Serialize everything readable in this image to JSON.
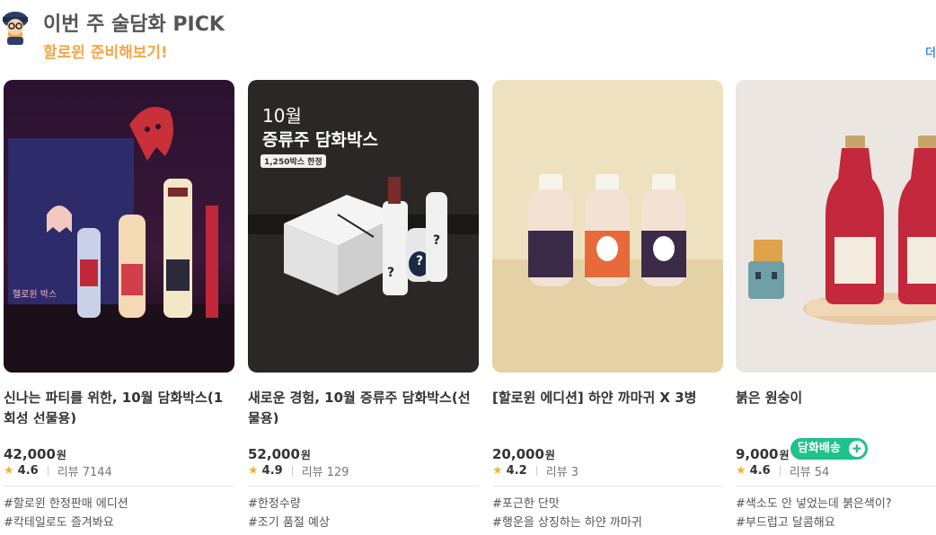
{
  "header": {
    "title": "이번 주 술담화 PICK",
    "subtitle": "할로윈 준비해보기!",
    "more_label": "더"
  },
  "colors": {
    "accent_orange": "#f6a64a",
    "star": "#f5b52a",
    "badge_green": "#1fc28a",
    "link_blue": "#3d8bf6"
  },
  "products": [
    {
      "name": "신나는 파티를 위한, 10월 담화박스(1회성 선물용)",
      "price": "42,000",
      "unit": "원",
      "rating": "4.6",
      "reviews": "리뷰 7144",
      "tags": [
        "#할로윈 한정판매 에디션",
        "#칵테일로도 즐겨봐요"
      ],
      "image_text": "헬로윈 박스"
    },
    {
      "name": "새로운 경험, 10월 증류주 담화박스(선물용)",
      "price": "52,000",
      "unit": "원",
      "rating": "4.9",
      "reviews": "리뷰 129",
      "tags": [
        "#한정수량",
        "#조기 품절 예상"
      ],
      "image_text": {
        "month": "10월",
        "headline": "증류주 담화박스",
        "limit": "1,250박스 한정"
      }
    },
    {
      "name": "[할로윈 에디션] 하얀 까마귀 X 3병",
      "price": "20,000",
      "unit": "원",
      "rating": "4.2",
      "reviews": "리뷰 3",
      "tags": [
        "#포근한 단맛",
        "#행운을 상징하는 하얀 까마귀"
      ]
    },
    {
      "name": "붉은 원숭이",
      "price": "9,000",
      "unit": "원",
      "rating": "4.6",
      "reviews": "리뷰 54",
      "badge": "담화배송",
      "tags": [
        "#색소도 안 넣었는데 붉은색이?",
        "#부드럽고 달콤해요"
      ]
    }
  ]
}
